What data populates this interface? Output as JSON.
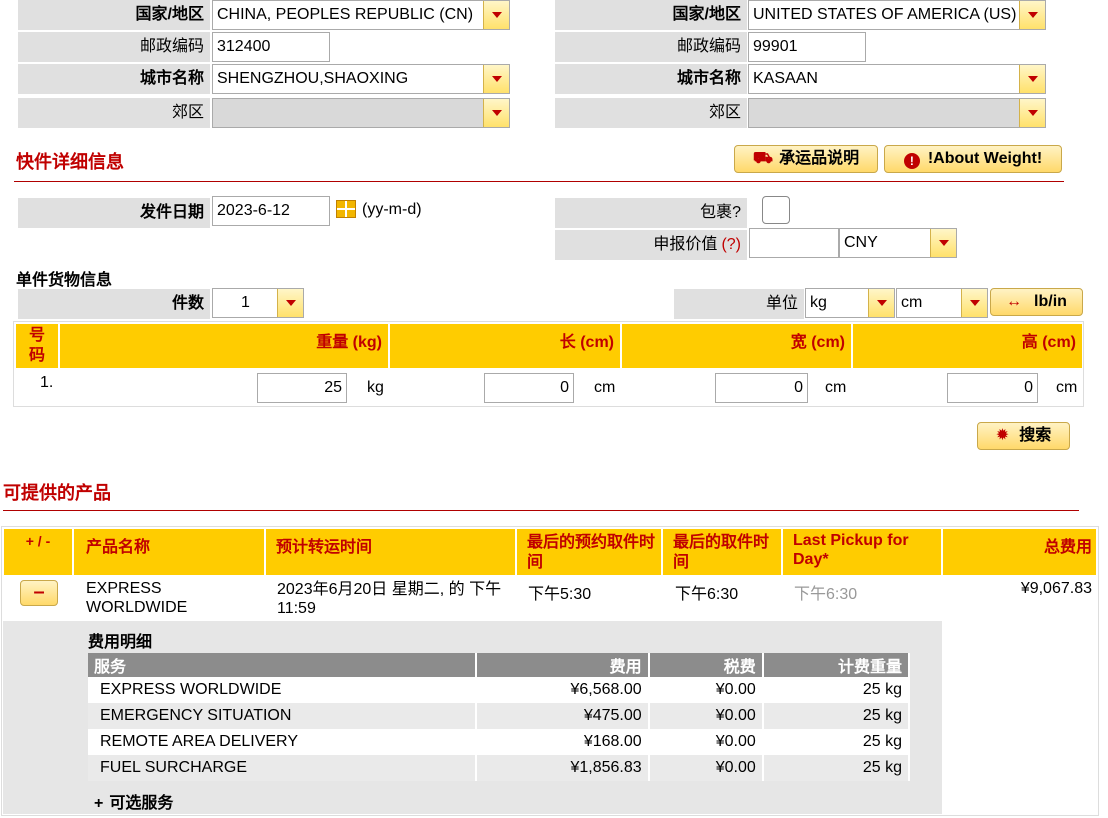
{
  "origin": {
    "country_label": "国家/地区",
    "country_value": "CHINA, PEOPLES REPUBLIC (CN)",
    "postcode_label": "邮政编码",
    "postcode_value": "312400",
    "city_label": "城市名称",
    "city_value": "SHENGZHOU,SHAOXING",
    "suburb_label": "郊区",
    "suburb_value": ""
  },
  "destination": {
    "country_label": "国家/地区",
    "country_value": "UNITED STATES OF AMERICA (US)",
    "postcode_label": "邮政编码",
    "postcode_value": "99901",
    "city_label": "城市名称",
    "city_value": "KASAAN",
    "suburb_label": "郊区",
    "suburb_value": ""
  },
  "details": {
    "title": "快件详细信息",
    "btn_carriage": "承运品说明",
    "btn_weight": "!About Weight!",
    "date_label": "发件日期",
    "date_value": "2023-6-12",
    "date_format": "(yy-m-d)",
    "package_label": "包裹?",
    "declared_label": "申报价值",
    "declared_help": "(?)",
    "declared_value": "",
    "currency": "CNY"
  },
  "cargo": {
    "title": "单件货物信息",
    "pieces_label": "件数",
    "pieces_value": "1",
    "unit_label": "单位",
    "unit_weight": "kg",
    "unit_length": "cm",
    "lbin_label": "lb/in",
    "headers": {
      "no": "号码",
      "weight": "重量 (kg)",
      "length": "长 (cm)",
      "width": "宽 (cm)",
      "height": "高 (cm)"
    },
    "row": {
      "no": "1.",
      "weight": "25",
      "weight_unit": "kg",
      "length": "0",
      "width": "0",
      "height": "0",
      "dim_unit": "cm"
    },
    "search_label": "搜索"
  },
  "products": {
    "title": "可提供的产品",
    "headers": {
      "toggle": "+ / -",
      "name": "产品名称",
      "transit": "预计转运时间",
      "last_booking": "最后的预约取件时间",
      "last_pickup": "最后的取件时间",
      "last_pickup_day": "Last Pickup for Day*",
      "total": "总费用"
    },
    "item": {
      "toggle": "–",
      "name": "EXPRESS WORLDWIDE",
      "transit": "2023年6月20日 星期二, 的 下午 11:59",
      "last_booking": "下午5:30",
      "last_pickup": "下午6:30",
      "last_pickup_day": "下午6:30",
      "total": "¥9,067.83"
    },
    "fee_title": "费用明细",
    "fee_headers": {
      "service": "服务",
      "fee": "费用",
      "tax": "税费",
      "weight": "计费重量"
    },
    "fees": [
      {
        "service": "EXPRESS WORLDWIDE",
        "fee": "¥6,568.00",
        "tax": "¥0.00",
        "weight": "25 kg"
      },
      {
        "service": "EMERGENCY SITUATION",
        "fee": "¥475.00",
        "tax": "¥0.00",
        "weight": "25 kg"
      },
      {
        "service": "REMOTE AREA DELIVERY",
        "fee": "¥168.00",
        "tax": "¥0.00",
        "weight": "25 kg"
      },
      {
        "service": "FUEL SURCHARGE",
        "fee": "¥1,856.83",
        "tax": "¥0.00",
        "weight": "25 kg"
      }
    ],
    "optional_label": "可选服务",
    "optional_prefix": "+"
  }
}
